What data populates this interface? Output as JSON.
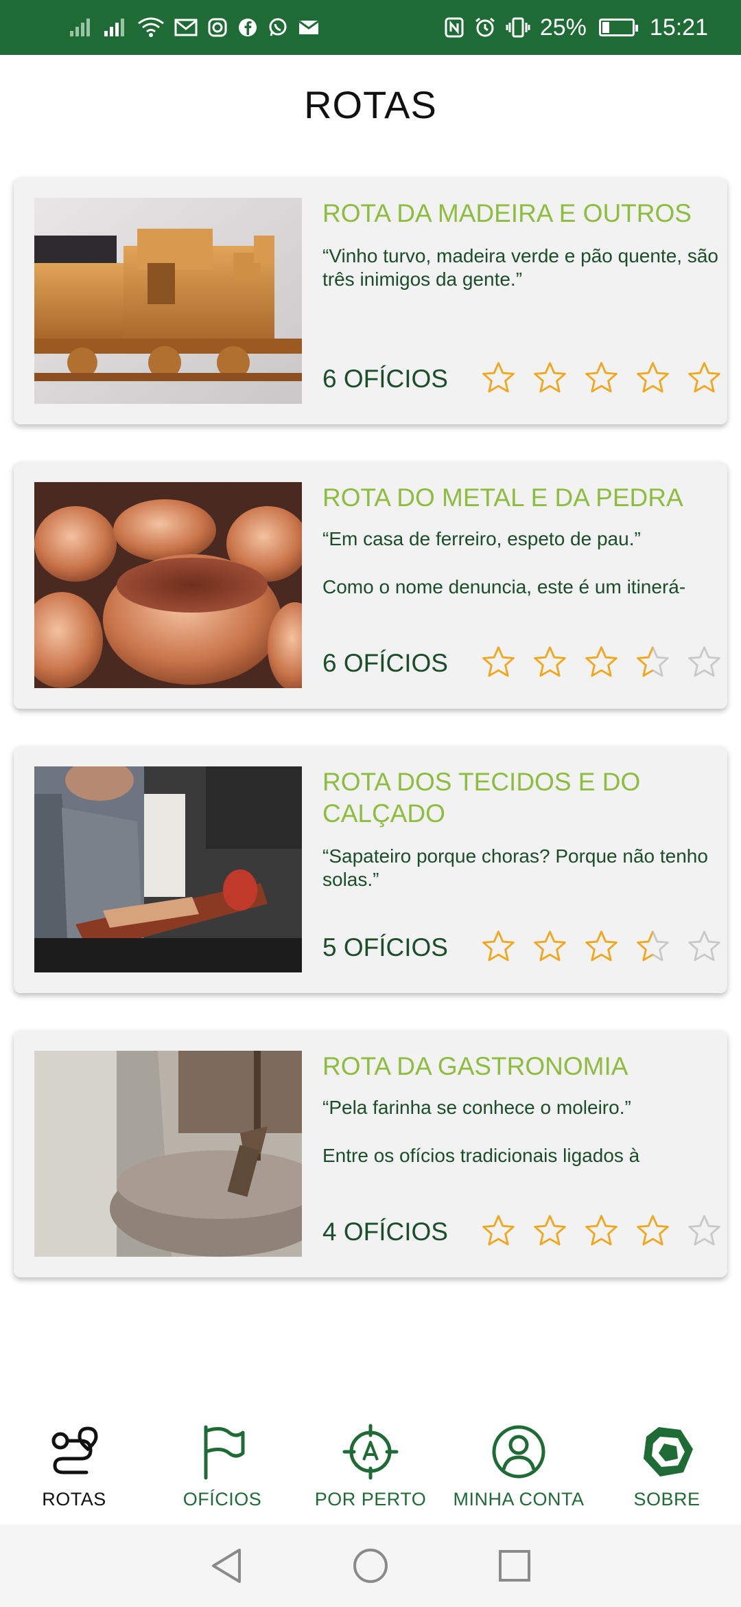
{
  "status_bar": {
    "battery": "25%",
    "time": "15:21",
    "left_icons": [
      "signal-icon",
      "signal-icon",
      "wifi-icon",
      "gmail-icon",
      "instagram-icon",
      "facebook-icon",
      "whatsapp-icon",
      "mail-icon"
    ],
    "right_icons": [
      "nfc-icon",
      "alarm-icon",
      "vibrate-icon",
      "battery-icon"
    ],
    "background_color": "#1f6b35"
  },
  "page": {
    "title": "ROTAS"
  },
  "routes": [
    {
      "title": "ROTA DA MADEIRA E OUTROS",
      "quote": "“Vinho turvo, madeira verde e pão quente, são três inimigos da gente.”",
      "description": "",
      "count_label": "6 OFÍCIOS",
      "rating": 5,
      "image": "wooden-train-photo"
    },
    {
      "title": "ROTA DO METAL E DA PEDRA",
      "quote": "“Em casa de ferreiro, espeto de pau.”",
      "description": "Como o nome denuncia, este é um itinerá-",
      "count_label": "6 OFÍCIOS",
      "rating": 3.5,
      "image": "copper-pots-photo"
    },
    {
      "title": "ROTA DOS TECIDOS E DO CALÇADO",
      "quote": "“Sapateiro porque choras? Porque não tenho solas.”",
      "description": "",
      "count_label": "5 OFÍCIOS",
      "rating": 3.5,
      "image": "shoemaker-photo"
    },
    {
      "title": "ROTA DA GASTRONOMIA",
      "quote": "“Pela farinha se conhece o moleiro.”",
      "description": "Entre os ofícios tradicionais ligados à",
      "count_label": "4 OFÍCIOS",
      "rating": 4,
      "image": "millstone-photo"
    }
  ],
  "bottom_nav": [
    {
      "label": "ROTAS",
      "icon": "route-icon",
      "active": true
    },
    {
      "label": "OFÍCIOS",
      "icon": "flag-icon",
      "active": false
    },
    {
      "label": "POR PERTO",
      "icon": "compass-target-icon",
      "active": false
    },
    {
      "label": "MINHA CONTA",
      "icon": "user-icon",
      "active": false
    },
    {
      "label": "SOBRE",
      "icon": "app-logo-icon",
      "active": false
    }
  ],
  "system_nav": [
    "back-icon",
    "home-icon",
    "recents-icon"
  ],
  "colors": {
    "brand_green": "#1f6b35",
    "title_green": "#8dbd3f",
    "text_dark_green": "#1b4d2a",
    "star_gold": "#f2a81d",
    "star_empty": "#c8c8c8",
    "card_bg": "#f2f2f2"
  }
}
